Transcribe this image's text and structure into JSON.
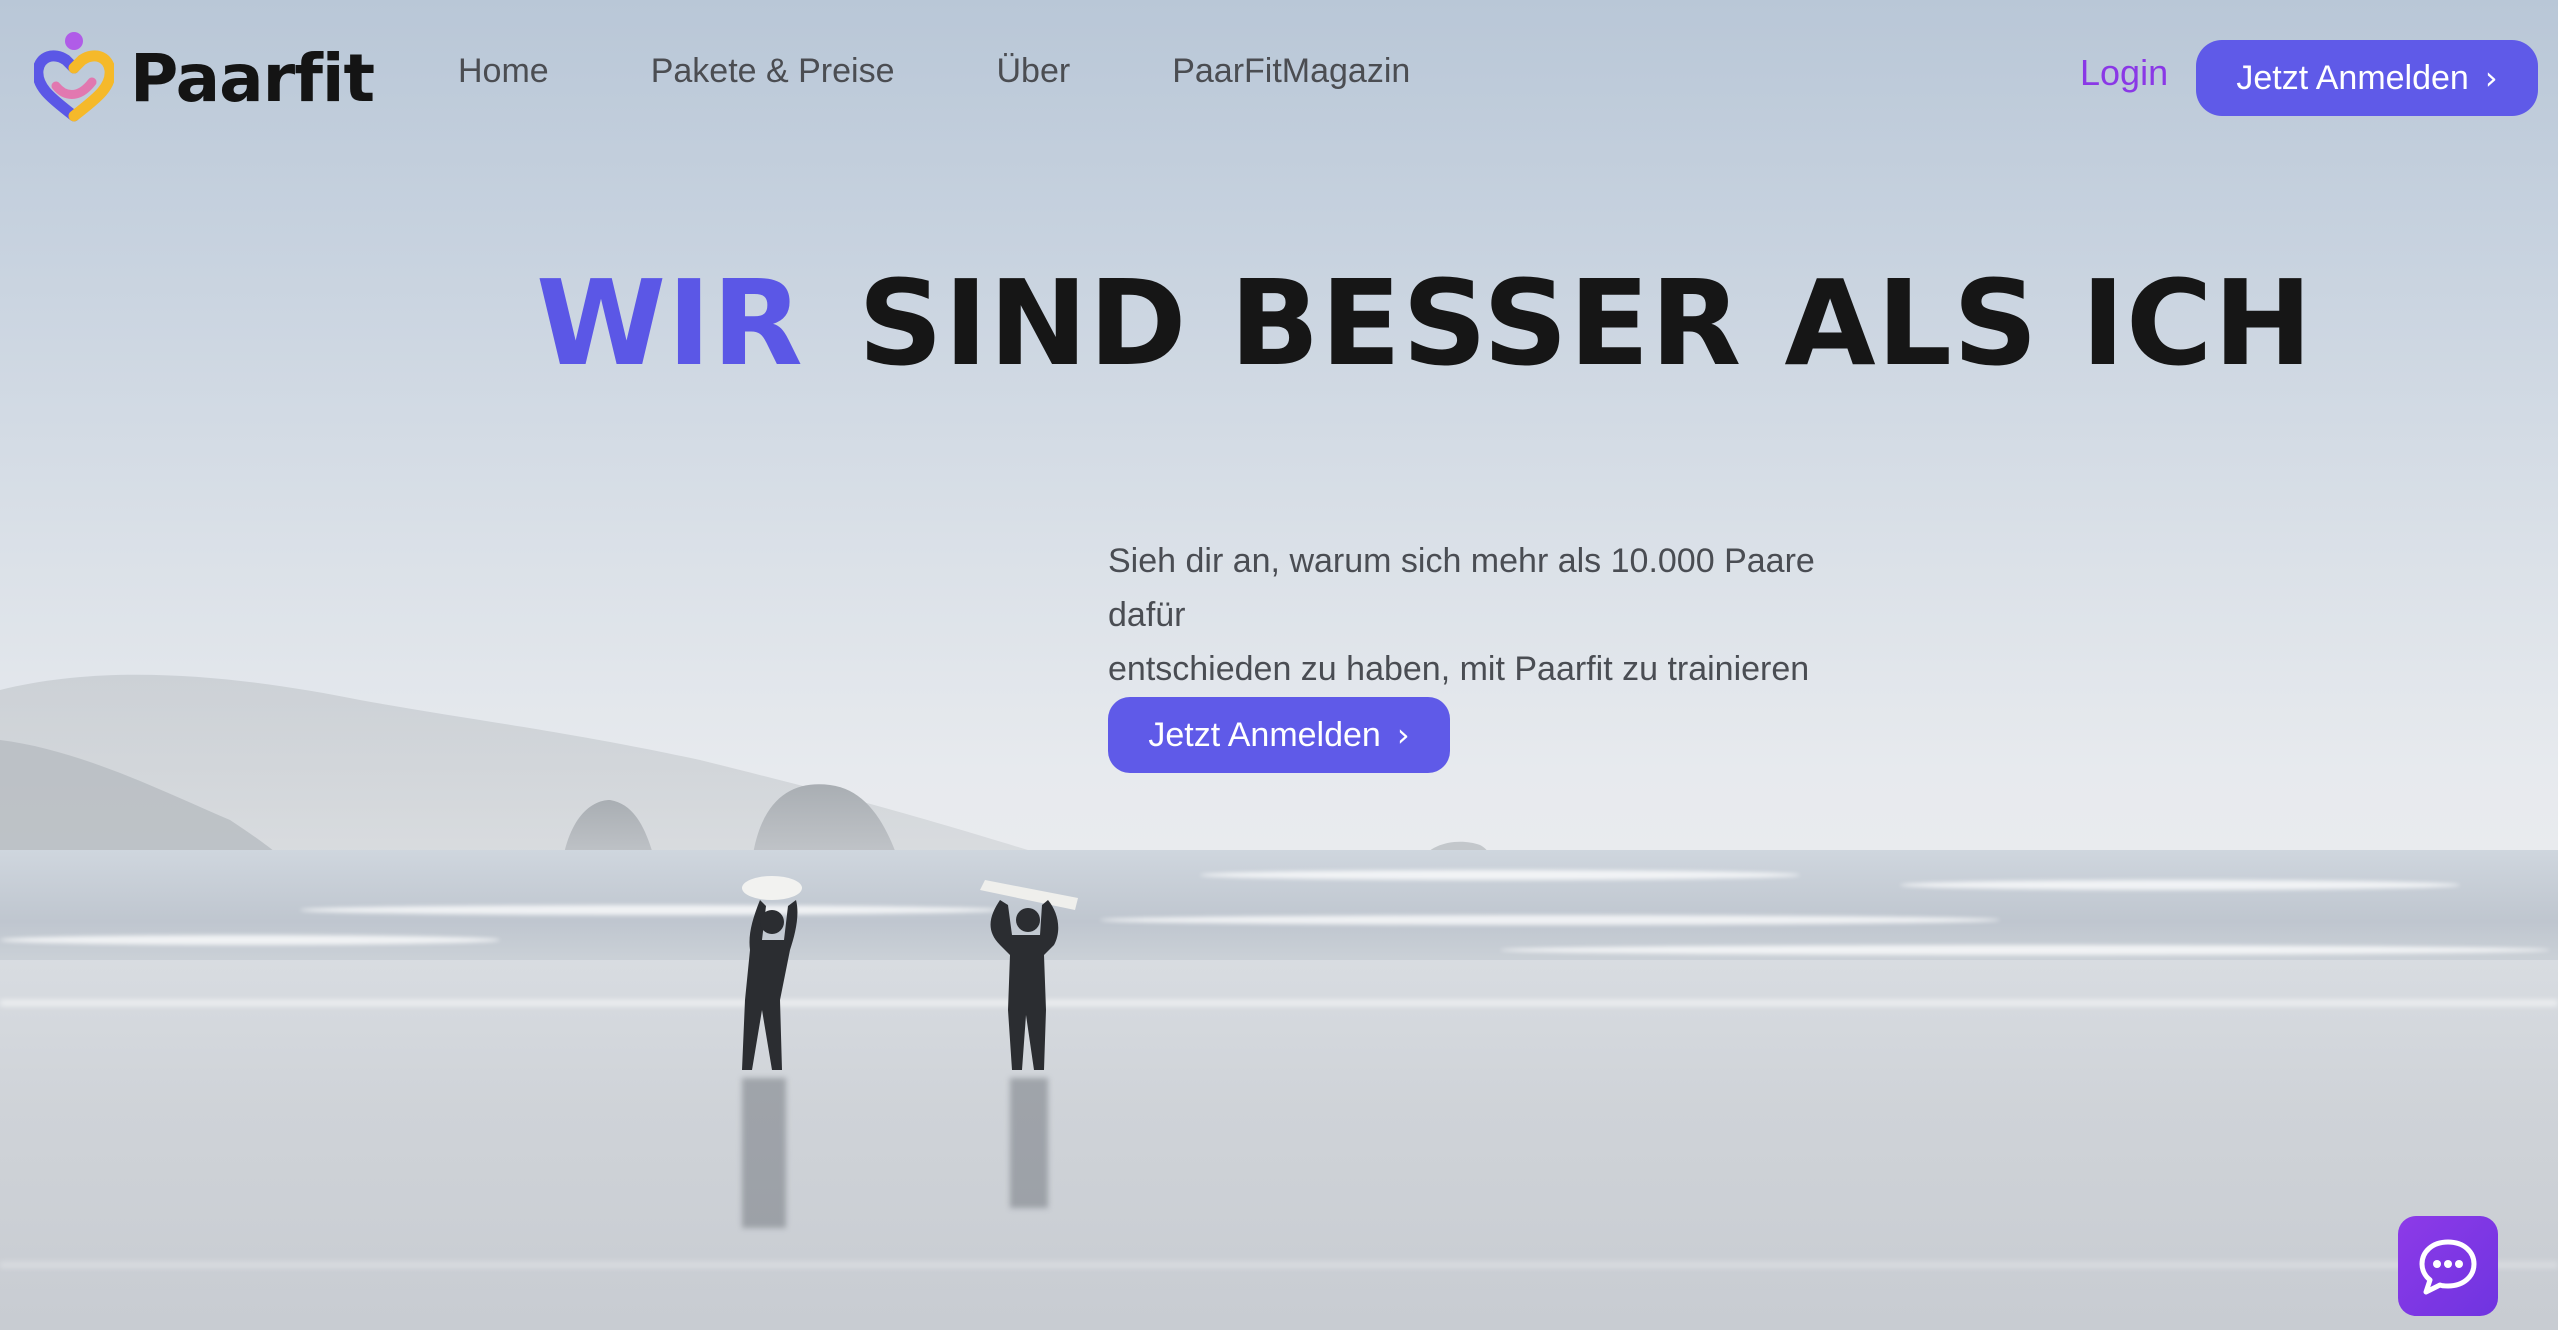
{
  "brand": {
    "name": "Paarfit",
    "logo_icon": "couple-heart-logo-icon"
  },
  "nav": {
    "items": [
      {
        "label": "Home"
      },
      {
        "label": "Pakete & Preise"
      },
      {
        "label": "Über"
      },
      {
        "label": "PaarFitMagazin"
      }
    ]
  },
  "header_actions": {
    "login_label": "Login",
    "signup_label": "Jetzt Anmelden",
    "signup_icon": "chevron-right-icon"
  },
  "hero": {
    "headline_accent": "WIR",
    "headline_rest": "SIND BESSER ALS ICH",
    "subtitle_line1": "Sieh dir an, warum sich mehr als 10.000 Paare dafür",
    "subtitle_line2": "entschieden zu haben, mit Paarfit zu trainieren",
    "cta_label": "Jetzt Anmelden",
    "cta_icon": "chevron-right-icon"
  },
  "chat": {
    "icon": "chat-bubble-icon"
  },
  "colors": {
    "accent": "#5b57e6",
    "button": "#5f5ae8",
    "login": "#8a38e6",
    "chat": "#8d3ae8",
    "text_dark": "#161616",
    "text_muted": "#4a4d53"
  }
}
